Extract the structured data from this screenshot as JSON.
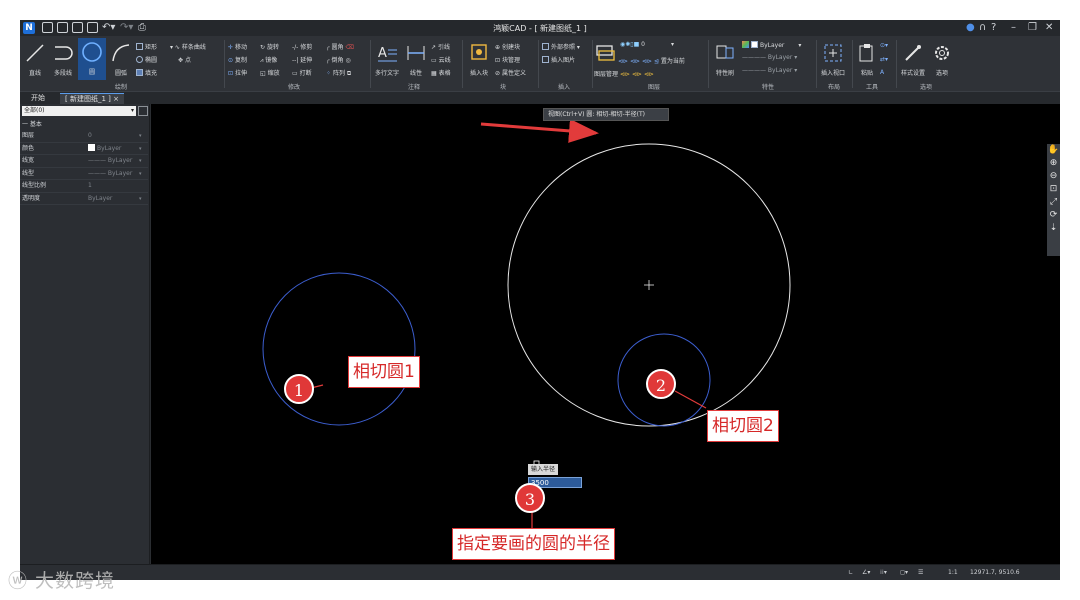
{
  "titlebar": {
    "app_logo": "N",
    "window_title": "鸿颖CAD - [ 新建图纸_1 ]",
    "icons": [
      "user-icon",
      "headset-icon",
      "help-icon",
      "minimize-icon",
      "restore-icon",
      "close-icon"
    ]
  },
  "ribbon": {
    "draw": {
      "title": "绘制",
      "line": "直线",
      "polyline": "多段线",
      "circle": "圆",
      "arc": "圆弧",
      "rect": "矩形",
      "ellipse": "椭圆",
      "hatch": "填充",
      "spline": "样条曲线",
      "point": "点"
    },
    "modify": {
      "title": "修改",
      "move": "移动",
      "rotate": "旋转",
      "trim": "修剪",
      "fillet": "圆角",
      "copy": "复制",
      "mirror": "镜像",
      "extend": "延伸",
      "chamfer": "倒角",
      "stretch": "拉伸",
      "scale": "缩放",
      "break": "打断",
      "array": "阵列"
    },
    "annotation": {
      "title": "注释",
      "mtext": "多行文字",
      "linear": "线性",
      "leader": "引线",
      "revcloud": "云线",
      "table": "表格"
    },
    "block": {
      "title": "块",
      "insert": "插入块",
      "create": "创建块",
      "manage": "块管理",
      "attdef": "属性定义"
    },
    "insert": {
      "title": "插入",
      "xref": "外部参照",
      "image": "插入图片"
    },
    "layers": {
      "title": "图层",
      "manager": "图层管理",
      "current_layer": "0",
      "set_current": "置为当前"
    },
    "properties": {
      "title": "特性",
      "match": "特性刷",
      "color": "ByLayer",
      "linetype": "ByLayer",
      "lineweight": "ByLayer"
    },
    "layout": {
      "title": "布局",
      "viewport": "插入视口"
    },
    "tools": {
      "title": "工具",
      "paste": "粘贴"
    },
    "options": {
      "title": "选项",
      "style_settings": "样式设置",
      "options": "选项"
    }
  },
  "tabs": [
    {
      "label": "开始"
    },
    {
      "label": "[ 新建图纸_1 ]"
    }
  ],
  "left_panel": {
    "selector": "全部(0)",
    "section": "一 基本",
    "rows": [
      {
        "key": "图层",
        "value": "0"
      },
      {
        "key": "颜色",
        "value": "ByLayer"
      },
      {
        "key": "线宽",
        "value": "ByLayer"
      },
      {
        "key": "线型",
        "value": "ByLayer"
      },
      {
        "key": "线型比例",
        "value": "1"
      },
      {
        "key": "透明度",
        "value": "ByLayer"
      }
    ]
  },
  "canvas": {
    "view_control": "视图(Ctrl+V)  圆: 相切-相切-半径(T)",
    "dimension_hint": "输入半径",
    "radius_value": "3500",
    "circle_colors": {
      "tangent": "#3c5ecf",
      "big": "#e8e8e8",
      "new": "#3c5ecf",
      "arrow": "#e23b3b"
    },
    "callouts": [
      {
        "num": "1",
        "text": "相切圆1"
      },
      {
        "num": "2",
        "text": "相切圆2"
      },
      {
        "num": "3",
        "text": "指定要画的圆的半径"
      }
    ],
    "nav_icons": [
      "pan-icon",
      "zoom-in-icon",
      "zoom-out-icon",
      "zoom-window-icon",
      "zoom-extents-icon",
      "orbit-icon",
      "more-icon"
    ]
  },
  "statusbar": {
    "scale": "1:1",
    "coords": "12971.7, 9510.6"
  },
  "watermark": "大数跨境"
}
